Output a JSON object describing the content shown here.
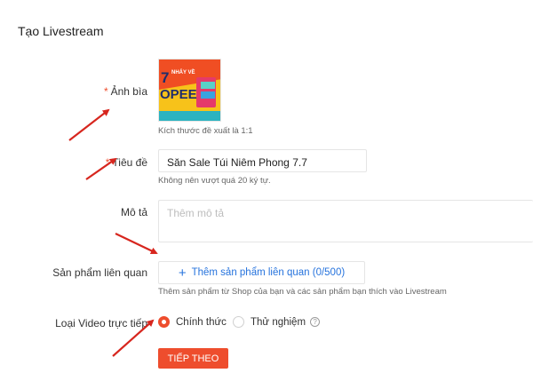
{
  "page": {
    "title": "Tạo Livestream"
  },
  "cover": {
    "label": "Ảnh bìa",
    "hint": "Kích thước đề xuất là 1:1",
    "thumb_text_top": "7",
    "thumb_text_mid": "NHẢY VỀ",
    "thumb_text_big": "OPEE"
  },
  "title_field": {
    "label": "Tiêu đề",
    "value": "Săn Sale Túi Niêm Phong 7.7",
    "hint": "Không nên vượt quá 20 ký tự."
  },
  "description": {
    "label": "Mô tả",
    "placeholder": "Thêm mô tả"
  },
  "related_products": {
    "label": "Sản phẩm liên quan",
    "button_label": "Thêm sản phẩm liên quan (0/500)",
    "hint": "Thêm sản phẩm từ Shop của bạn và các sản phẩm bạn thích vào Livestream"
  },
  "video_type": {
    "label": "Loại Video trực tiếp",
    "options": [
      {
        "label": "Chính thức",
        "selected": true
      },
      {
        "label": "Thử nghiệm",
        "selected": false
      }
    ],
    "help_glyph": "?"
  },
  "next_button": {
    "label": "TIẾP THEO"
  },
  "colors": {
    "accent": "#ee4d2d",
    "link": "#2673dd",
    "annotation_arrow": "#d7261e"
  },
  "icons": [
    "plus-icon",
    "help-icon",
    "annotation-arrow-icon"
  ]
}
